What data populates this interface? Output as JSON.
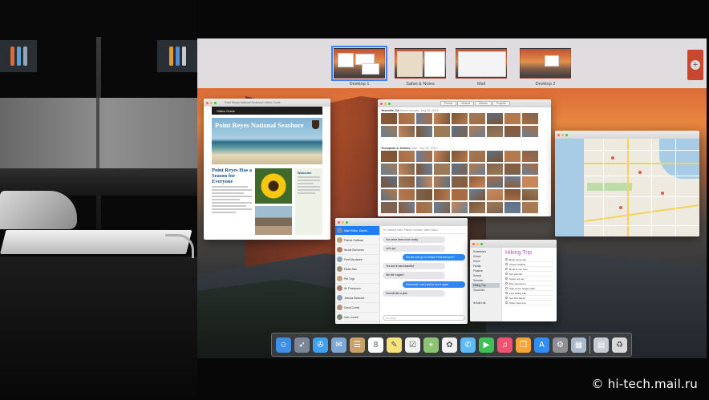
{
  "spaces_bar": {
    "spaces": [
      {
        "label": "Desktop 1",
        "active": true
      },
      {
        "label": "Safari & Notes",
        "active": false
      },
      {
        "label": "Mail",
        "active": false
      },
      {
        "label": "Desktop 2",
        "active": false
      }
    ],
    "add_space_glyph": "+"
  },
  "safari": {
    "window_title": "Point Reyes National Seashore Visitor Guide",
    "guide_header": "Visitor Guide",
    "hero_title": "Point Reyes National Seashore",
    "hero_subtitle": "",
    "article_heading": "Point Reyes Has a Season for Everyone",
    "sidebar_heading": "Welcome"
  },
  "photos": {
    "toolbar_tabs": [
      "Photos",
      "Shared",
      "Albums",
      "Projects"
    ],
    "section1_title": "Yosemite, CA",
    "section1_date": "Sierra Nevada · Aug 26, 2014",
    "section2_title": "Thompson & Jenkins",
    "section2_date": "Utah · Sep 26, 2014",
    "row_colors": [
      "#8b5a3a",
      "#a86b44",
      "#6b7e94",
      "#c8875a",
      "#7a5536",
      "#9c7a58",
      "#5f6f84",
      "#b47a4e",
      "#7d6450"
    ]
  },
  "maps": {
    "window_title": "Maps"
  },
  "messages": {
    "to_line": "To: Danielle Diaz, Patrick Garrison, Mike Killion",
    "conversations": [
      {
        "name": "Mike Killion, Daniel...",
        "color": "#7b8fa6"
      },
      {
        "name": "Patrick Gaffman",
        "color": "#c79c7a"
      },
      {
        "name": "Nicole Borromeo",
        "color": "#b07a5a"
      },
      {
        "name": "Fred Morrissey",
        "color": "#8aa3b8"
      },
      {
        "name": "Eddie Mac",
        "color": "#9b8f7e"
      },
      {
        "name": "Pat Trigs",
        "color": "#c9a27b"
      },
      {
        "name": "Ali Thompson",
        "color": "#a97e6a"
      },
      {
        "name": "Jessica Belasher",
        "color": "#8e9aa8"
      },
      {
        "name": "David Curtail",
        "color": "#b59376"
      },
      {
        "name": "Ivan Linnett",
        "color": "#7f8b72"
      },
      {
        "name": "Sabina Rendy",
        "color": "#c0a08c"
      }
    ],
    "bubbles": [
      {
        "dir": "in",
        "text": "I've never been more ready"
      },
      {
        "dir": "in",
        "text": "Let's go!"
      },
      {
        "dir": "out",
        "text": "Did we ever go to Glacier Point last year?"
      },
      {
        "dir": "in",
        "text": "Yes and it was beautiful!"
      },
      {
        "dir": "in",
        "text": "We did it again!"
      },
      {
        "dir": "out",
        "text": "Awesome! I can't wait to see it again"
      },
      {
        "dir": "in",
        "text": "Sounds like a plan"
      }
    ],
    "input_placeholder": "iMessage"
  },
  "reminders": {
    "lists": [
      "Scheduled",
      "iCloud",
      "Home",
      "Family",
      "Finance",
      "School",
      "Summer",
      "Hiking Trip",
      "Groceries"
    ],
    "selected_list": "Hiking Trip",
    "title": "Hiking Trip",
    "items": [
      "Book camp site",
      "Check weather",
      "Book in sun fees",
      "Get permits",
      "Clean out car",
      "Buy sunscreen",
      "Sign up for ranger walk",
      "Find hiking trail",
      "Get first aid kit",
      "Order new tent"
    ],
    "add_list": "Add List"
  },
  "dock": {
    "icons": [
      {
        "name": "finder-icon",
        "bg": "#3d8fe8",
        "glyph": "☺"
      },
      {
        "name": "launchpad-icon",
        "bg": "#7b8797",
        "glyph": "➶"
      },
      {
        "name": "safari-icon",
        "bg": "#3ea0f0",
        "glyph": "✇"
      },
      {
        "name": "mail-stamp-icon",
        "bg": "#7fa7d6",
        "glyph": "✉"
      },
      {
        "name": "contacts-icon",
        "bg": "#c9a26a",
        "glyph": "☰"
      },
      {
        "name": "calendar-icon",
        "bg": "#ffffff",
        "glyph": "8"
      },
      {
        "name": "notes-icon",
        "bg": "#f7e27a",
        "glyph": "✎"
      },
      {
        "name": "reminders-icon",
        "bg": "#f2f2f2",
        "glyph": "☑"
      },
      {
        "name": "maps-icon",
        "bg": "#8bc473",
        "glyph": "⌖"
      },
      {
        "name": "photos-icon",
        "bg": "#f1f1f1",
        "glyph": "✿"
      },
      {
        "name": "messages-icon",
        "bg": "#5eb9f7",
        "glyph": "✆"
      },
      {
        "name": "facetime-icon",
        "bg": "#3fbf57",
        "glyph": "▶"
      },
      {
        "name": "itunes-icon",
        "bg": "#f05270",
        "glyph": "♫"
      },
      {
        "name": "ibooks-icon",
        "bg": "#f4a53a",
        "glyph": "❒"
      },
      {
        "name": "app-store-icon",
        "bg": "#2f8ff2",
        "glyph": "A"
      },
      {
        "name": "system-preferences-icon",
        "bg": "#8e8e93",
        "glyph": "⚙"
      },
      {
        "name": "preview-icon",
        "bg": "#aab9c9",
        "glyph": "▦"
      },
      {
        "name": "finder-folder-icon",
        "bg": "#c7ccd3",
        "glyph": "▤"
      },
      {
        "name": "trash-icon",
        "bg": "#d9d9d9",
        "glyph": "♻"
      }
    ]
  },
  "watermark": "© hi-tech.mail.ru",
  "colors": {
    "active_space_outline": "#3c82f0",
    "messages_accent": "#1f7cf6",
    "reminders_title": "#b553d0"
  }
}
